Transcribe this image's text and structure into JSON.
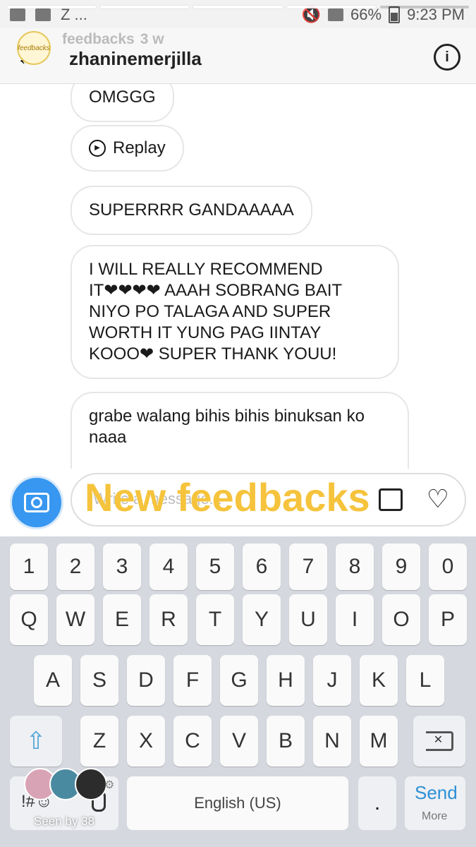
{
  "status_bar": {
    "carrier_z": "Z ...",
    "battery": "66%",
    "time": "9:23 PM"
  },
  "story": {
    "account": "feedbacks",
    "age": "3 w",
    "avatar_text": "feedbacks",
    "seen_by": "Seen by 38",
    "sticker_text": "New feedbacks"
  },
  "header": {
    "title": "zhaninemerjilla",
    "info_glyph": "i"
  },
  "messages": [
    {
      "text": "OMGGG"
    },
    {
      "text": "Replay",
      "type": "replay"
    },
    {
      "text": "SUPERRRR GANDAAAAA"
    },
    {
      "text": "I WILL REALLY RECOMMEND\nIT❤❤❤❤ AAAH SOBRANG BAIT\nNIYO PO TALAGA AND SUPER\nWORTH IT YUNG PAG IINTAY\nKOOO❤ SUPER THANK YOUU!"
    },
    {
      "text": "grabe walang bihis bihis binuksan ko\nnaaa"
    }
  ],
  "composer": {
    "placeholder": "Write a message..."
  },
  "keyboard": {
    "numbers": [
      "1",
      "2",
      "3",
      "4",
      "5",
      "6",
      "7",
      "8",
      "9",
      "0"
    ],
    "row1": [
      "Q",
      "W",
      "E",
      "R",
      "T",
      "Y",
      "U",
      "I",
      "O",
      "P"
    ],
    "row2": [
      "A",
      "S",
      "D",
      "F",
      "G",
      "H",
      "J",
      "K",
      "L"
    ],
    "row3": [
      "Z",
      "X",
      "C",
      "V",
      "B",
      "N",
      "M"
    ],
    "symbols_label": "!#☺",
    "space_label": "English (US)",
    "period": ".",
    "send_label": "Send",
    "more_label": "More"
  },
  "colors": {
    "accent_blue": "#3897f0",
    "sticker_yellow": "#f5c33c",
    "heart_red": "#e81423"
  }
}
